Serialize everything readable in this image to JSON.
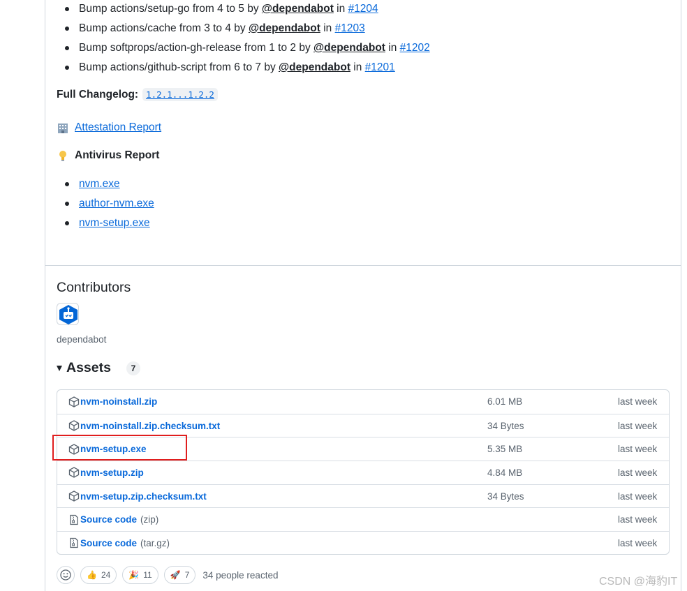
{
  "notes": [
    {
      "text": "Bump actions/setup-go from 4 to 5 by ",
      "mention": "@dependabot",
      "in": " in ",
      "issue": "#1204"
    },
    {
      "text": "Bump actions/cache from 3 to 4 by ",
      "mention": "@dependabot",
      "in": " in ",
      "issue": "#1203"
    },
    {
      "text": "Bump softprops/action-gh-release from 1 to 2 by ",
      "mention": "@dependabot",
      "in": " in ",
      "issue": "#1202"
    },
    {
      "text": "Bump actions/github-script from 6 to 7 by ",
      "mention": "@dependabot",
      "in": " in ",
      "issue": "#1201"
    }
  ],
  "changelog": {
    "label": "Full Changelog:",
    "range": "1.2.1...1.2.2"
  },
  "attestation": {
    "label": "Attestation Report",
    "icon": "office-building-icon"
  },
  "antivirus": {
    "label": "Antivirus Report",
    "icon": "light-bulb-icon",
    "links": [
      "nvm.exe",
      "author-nvm.exe",
      "nvm-setup.exe"
    ]
  },
  "contributors": {
    "title": "Contributors",
    "name": "dependabot"
  },
  "assets": {
    "title": "Assets",
    "count": "7",
    "rows": [
      {
        "name": "nvm-noinstall.zip",
        "format": "",
        "size": "6.01 MB",
        "date": "last week",
        "icon": "package-icon"
      },
      {
        "name": "nvm-noinstall.zip.checksum.txt",
        "format": "",
        "size": "34 Bytes",
        "date": "last week",
        "icon": "package-icon"
      },
      {
        "name": "nvm-setup.exe",
        "format": "",
        "size": "5.35 MB",
        "date": "last week",
        "icon": "package-icon"
      },
      {
        "name": "nvm-setup.zip",
        "format": "",
        "size": "4.84 MB",
        "date": "last week",
        "icon": "package-icon"
      },
      {
        "name": "nvm-setup.zip.checksum.txt",
        "format": "",
        "size": "34 Bytes",
        "date": "last week",
        "icon": "package-icon"
      },
      {
        "name": "Source code",
        "format": "(zip)",
        "size": "",
        "date": "last week",
        "icon": "file-zip-icon"
      },
      {
        "name": "Source code",
        "format": "(tar.gz)",
        "size": "",
        "date": "last week",
        "icon": "file-zip-icon"
      }
    ]
  },
  "reactions": {
    "items": [
      {
        "emoji": "👍",
        "count": "24"
      },
      {
        "emoji": "🎉",
        "count": "11"
      },
      {
        "emoji": "🚀",
        "count": "7"
      }
    ],
    "summary": "34 people reacted"
  },
  "watermark": "CSDN @海豹IT",
  "colors": {
    "link": "#0969da",
    "highlight": "#e01e1e",
    "border": "#d0d7de"
  }
}
